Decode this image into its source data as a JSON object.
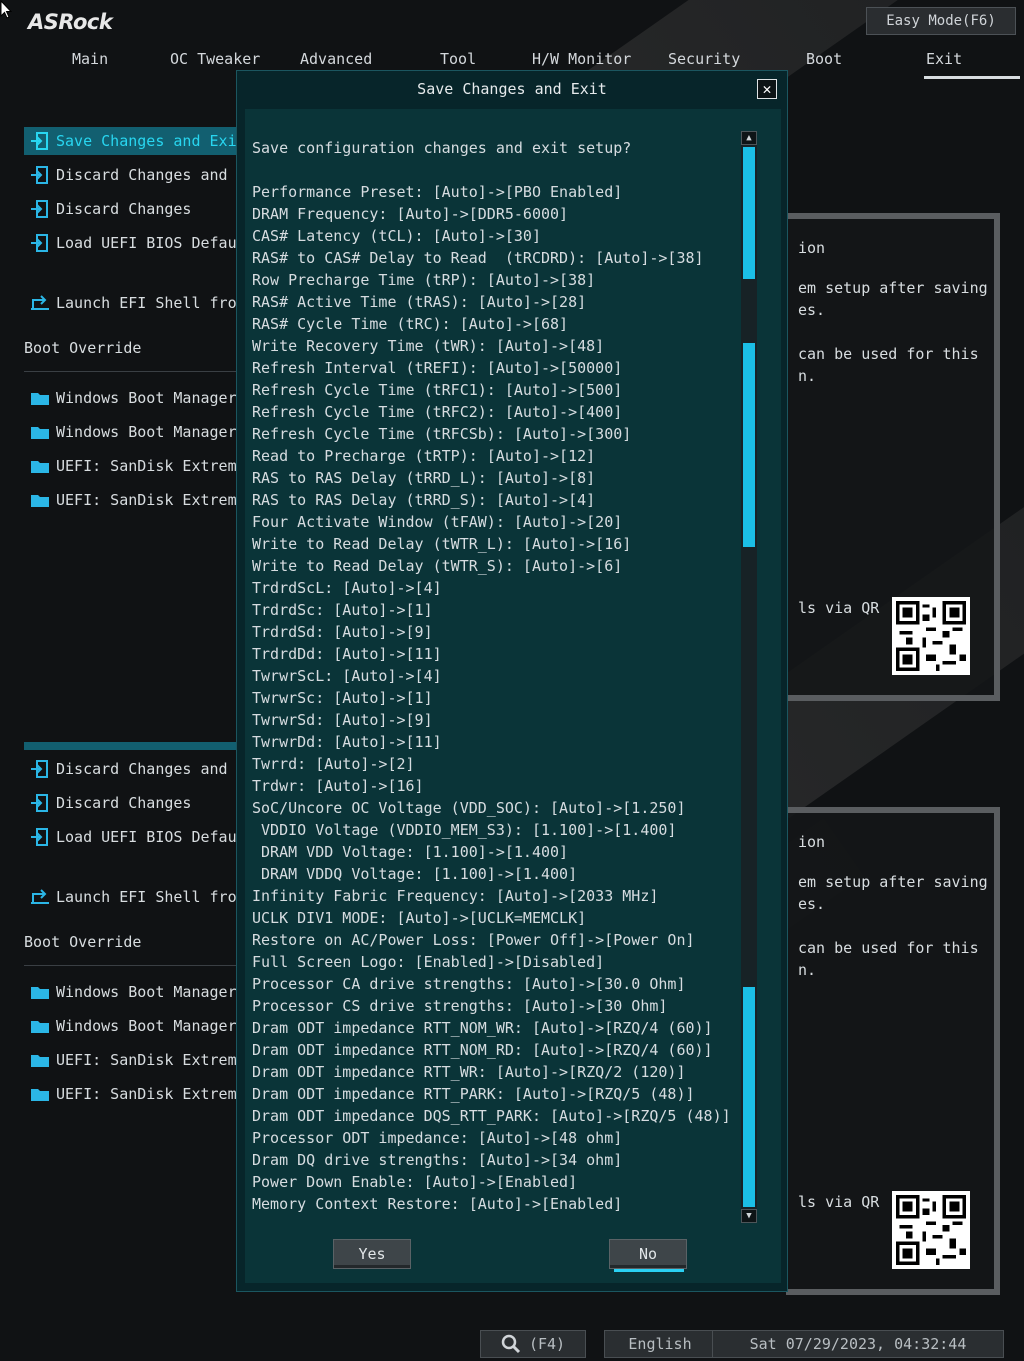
{
  "brand": "ASRock",
  "easy_mode_label": "Easy Mode(F6)",
  "tabs": [
    "Main",
    "OC Tweaker",
    "Advanced",
    "Tool",
    "H/W Monitor",
    "Security",
    "Boot",
    "Exit"
  ],
  "active_tab": "Exit",
  "left_menu": {
    "items": [
      {
        "label": "Save Changes and Exit",
        "selected": true
      },
      {
        "label": "Discard Changes and E",
        "selected": false
      },
      {
        "label": "Discard Changes",
        "selected": false
      },
      {
        "label": "Load UEFI BIOS Defaul",
        "selected": false
      }
    ],
    "launch_label": "Launch EFI Shell from",
    "boot_override_title": "Boot Override",
    "boot_items": [
      "Windows Boot Manager",
      "Windows Boot Manager",
      "UEFI: SanDisk Extreme",
      "UEFI: SanDisk Extreme"
    ]
  },
  "left_menu_lower": {
    "items": [
      {
        "label": "Discard Changes and E"
      },
      {
        "label": "Discard Changes"
      },
      {
        "label": "Load UEFI BIOS Defaul"
      }
    ],
    "launch_label": "Launch EFI Shell from",
    "boot_override_title": "Boot Override",
    "boot_items": [
      "Windows Boot Manager",
      "Windows Boot Manager",
      "UEFI: SanDisk Extreme",
      "UEFI: SanDisk Extreme"
    ]
  },
  "right_panel": {
    "heading_fragment": "ion",
    "line1": "em setup after saving",
    "line2": "es.",
    "line3": "can be used for this",
    "line4": "n.",
    "qr_label": "ls via QR"
  },
  "modal": {
    "title": "Save Changes and Exit",
    "question": "Save configuration changes and exit setup?",
    "lines": [
      "Performance Preset: [Auto]->[PBO Enabled]",
      "DRAM Frequency: [Auto]->[DDR5-6000]",
      "CAS# Latency (tCL): [Auto]->[30]",
      "RAS# to CAS# Delay to Read  (tRCDRD): [Auto]->[38]",
      "Row Precharge Time (tRP): [Auto]->[38]",
      "RAS# Active Time (tRAS): [Auto]->[28]",
      "RAS# Cycle Time (tRC): [Auto]->[68]",
      "Write Recovery Time (tWR): [Auto]->[48]",
      "Refresh Interval (tREFI): [Auto]->[50000]",
      "Refresh Cycle Time (tRFC1): [Auto]->[500]",
      "Refresh Cycle Time (tRFC2): [Auto]->[400]",
      "Refresh Cycle Time (tRFCSb): [Auto]->[300]",
      "Read to Precharge (tRTP): [Auto]->[12]",
      "RAS to RAS Delay (tRRD_L): [Auto]->[8]",
      "RAS to RAS Delay (tRRD_S): [Auto]->[4]",
      "Four Activate Window (tFAW): [Auto]->[20]",
      "Write to Read Delay (tWTR_L): [Auto]->[16]",
      "Write to Read Delay (tWTR_S): [Auto]->[6]",
      "TrdrdScL: [Auto]->[4]",
      "TrdrdSc: [Auto]->[1]",
      "TrdrdSd: [Auto]->[9]",
      "TrdrdDd: [Auto]->[11]",
      "TwrwrScL: [Auto]->[4]",
      "TwrwrSc: [Auto]->[1]",
      "TwrwrSd: [Auto]->[9]",
      "TwrwrDd: [Auto]->[11]",
      "Twrrd: [Auto]->[2]",
      "Trdwr: [Auto]->[16]",
      "SoC/Uncore OC Voltage (VDD_SOC): [Auto]->[1.250]",
      " VDDIO Voltage (VDDIO_MEM_S3): [1.100]->[1.400]",
      " DRAM VDD Voltage: [1.100]->[1.400]",
      " DRAM VDDQ Voltage: [1.100]->[1.400]",
      "Infinity Fabric Frequency: [Auto]->[2033 MHz]",
      "UCLK DIV1 MODE: [Auto]->[UCLK=MEMCLK]",
      "Restore on AC/Power Loss: [Power Off]->[Power On]",
      "Full Screen Logo: [Enabled]->[Disabled]",
      "Processor CA drive strengths: [Auto]->[30.0 Ohm]",
      "Processor CS drive strengths: [Auto]->[30 Ohm]",
      "Dram ODT impedance RTT_NOM_WR: [Auto]->[RZQ/4 (60)]",
      "Dram ODT impedance RTT_NOM_RD: [Auto]->[RZQ/4 (60)]",
      "Dram ODT impedance RTT_WR: [Auto]->[RZQ/2 (120)]",
      "Dram ODT impedance RTT_PARK: [Auto]->[RZQ/5 (48)]",
      "Dram ODT impedance DQS_RTT_PARK: [Auto]->[RZQ/5 (48)]",
      "Processor ODT impedance: [Auto]->[48 ohm]",
      "Dram DQ drive strengths: [Auto]->[34 ohm]",
      "Power Down Enable: [Auto]->[Enabled]",
      "Memory Context Restore: [Auto]->[Enabled]"
    ],
    "yes_label": "Yes",
    "no_label": "No",
    "selected_button": "No"
  },
  "footer": {
    "search_key": "(F4)",
    "language": "English",
    "datetime": "Sat 07/29/2023, 04:32:44"
  },
  "colors": {
    "accent": "#1bbfe6",
    "selected_bg": "#125f70",
    "modal_bg": "#0a3438"
  }
}
